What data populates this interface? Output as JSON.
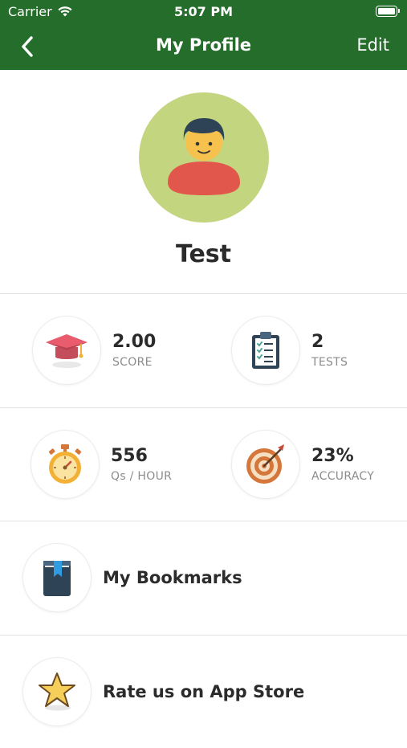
{
  "status_bar": {
    "carrier": "Carrier",
    "time": "5:07 PM"
  },
  "nav": {
    "title": "My Profile",
    "edit_label": "Edit",
    "back_icon": "chevron-left-icon"
  },
  "profile": {
    "name": "Test",
    "avatar_icon": "user-avatar-icon"
  },
  "stats": {
    "score": {
      "value": "2.00",
      "label": "SCORE",
      "icon": "graduation-cap-icon"
    },
    "tests": {
      "value": "2",
      "label": "TESTS",
      "icon": "clipboard-checklist-icon"
    },
    "speed": {
      "value": "556",
      "label": "Qs / HOUR",
      "icon": "stopwatch-icon"
    },
    "accuracy": {
      "value": "23%",
      "label": "ACCURACY",
      "icon": "target-icon"
    }
  },
  "menu": {
    "bookmarks": {
      "label": "My Bookmarks",
      "icon": "bookmark-book-icon"
    },
    "rate": {
      "label": "Rate us on App Store",
      "icon": "star-icon"
    }
  },
  "colors": {
    "header_bg": "#246d2a",
    "avatar_bg": "#c3d57e"
  }
}
